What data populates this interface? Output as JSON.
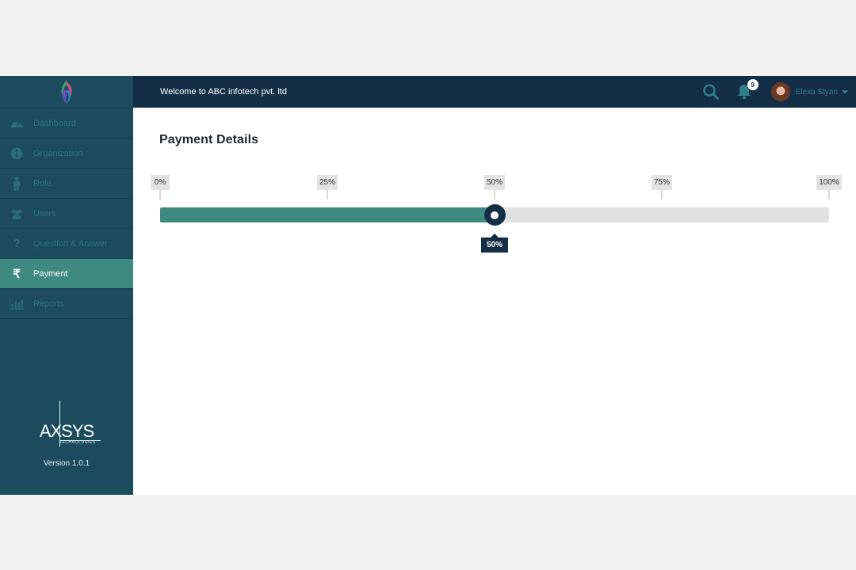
{
  "app": {
    "welcome_text": "Welcome to ABC infotech pvt. ltd",
    "notifications_count": "9",
    "user_name": "Elexa Styan"
  },
  "sidebar": {
    "items": [
      {
        "label": "Dashboard",
        "icon": "dashboard-icon",
        "active": false
      },
      {
        "label": "Organization",
        "icon": "info-icon",
        "active": false
      },
      {
        "label": "Role",
        "icon": "person-icon",
        "active": false
      },
      {
        "label": "Users",
        "icon": "users-icon",
        "active": false
      },
      {
        "label": "Question & Answer",
        "icon": "question-icon",
        "active": false
      },
      {
        "label": "Payment",
        "icon": "rupee-icon",
        "active": true
      },
      {
        "label": "Reports",
        "icon": "bar-chart-icon",
        "active": false
      }
    ],
    "brand_name": "AXSYS",
    "brand_sub": "TECHNOLOGIES",
    "version": "Version 1.0.1"
  },
  "main": {
    "title": "Payment Details",
    "slider": {
      "ticks": [
        "0%",
        "25%",
        "50%",
        "75%",
        "100%"
      ],
      "value_percent": 50,
      "value_label": "50%"
    }
  },
  "colors": {
    "sidebar_bg": "#1c4b5e",
    "topbar_bg": "#142f45",
    "accent": "#3e8a80",
    "track": "#e1e1e1"
  }
}
